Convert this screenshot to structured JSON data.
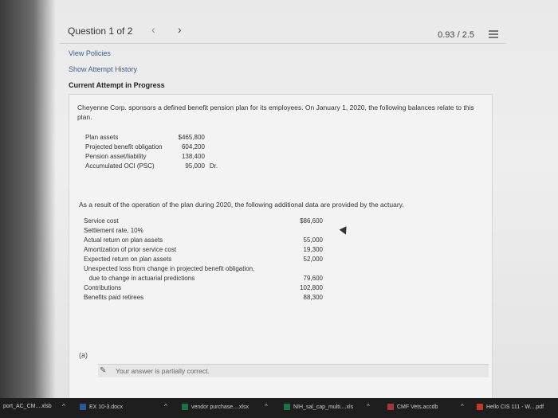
{
  "header": {
    "question_label": "Question 1 of 2",
    "prev_icon": "chevron-left-icon",
    "next_icon": "chevron-right-icon",
    "score": "0.93 / 2.5",
    "menu_icon": "list-icon"
  },
  "links": {
    "view_policies": "View Policies",
    "show_attempt_history": "Show Attempt History",
    "current_attempt": "Current Attempt in Progress"
  },
  "problem": {
    "intro": "Cheyenne Corp. sponsors a defined benefit pension plan for its employees. On January 1, 2020, the following balances relate to this plan.",
    "balances": [
      {
        "label": "Plan assets",
        "value": "$465,800",
        "suffix": ""
      },
      {
        "label": "Projected benefit obligation",
        "value": "604,200",
        "suffix": ""
      },
      {
        "label": "Pension asset/liability",
        "value": "138,400",
        "suffix": ""
      },
      {
        "label": "Accumulated OCI (PSC)",
        "value": "95,000",
        "suffix": "Dr."
      }
    ],
    "para2": "As a result of the operation of the plan during 2020, the following additional data are provided by the actuary.",
    "additional": [
      {
        "label": "Service cost",
        "value": "$86,600"
      },
      {
        "label": "Settlement rate, 10%",
        "value": ""
      },
      {
        "label": "Actual return on plan assets",
        "value": "55,000"
      },
      {
        "label": "Amortization of prior service cost",
        "value": "19,300"
      },
      {
        "label": "Expected return on plan assets",
        "value": "52,000"
      },
      {
        "label": "Unexpected loss from change in projected benefit obligation,",
        "value": ""
      },
      {
        "label": "   due to change in actuarial predictions",
        "value": "79,600"
      },
      {
        "label": "Contributions",
        "value": "102,800"
      },
      {
        "label": "Benefits paid retirees",
        "value": "88,300"
      }
    ],
    "part_label": "(a)",
    "notice": "Your answer is partially correct."
  },
  "taskbar": {
    "items": [
      {
        "label": "port_AC_CM....xlsb"
      },
      {
        "label": "EX 10-3.docx"
      },
      {
        "label": "vendor purchase....xlsx"
      },
      {
        "label": "NIH_sal_cap_multi....xls"
      },
      {
        "label": "CMF Vets.accdb"
      },
      {
        "label": "Hello CIS 111 - W....pdf"
      }
    ]
  }
}
